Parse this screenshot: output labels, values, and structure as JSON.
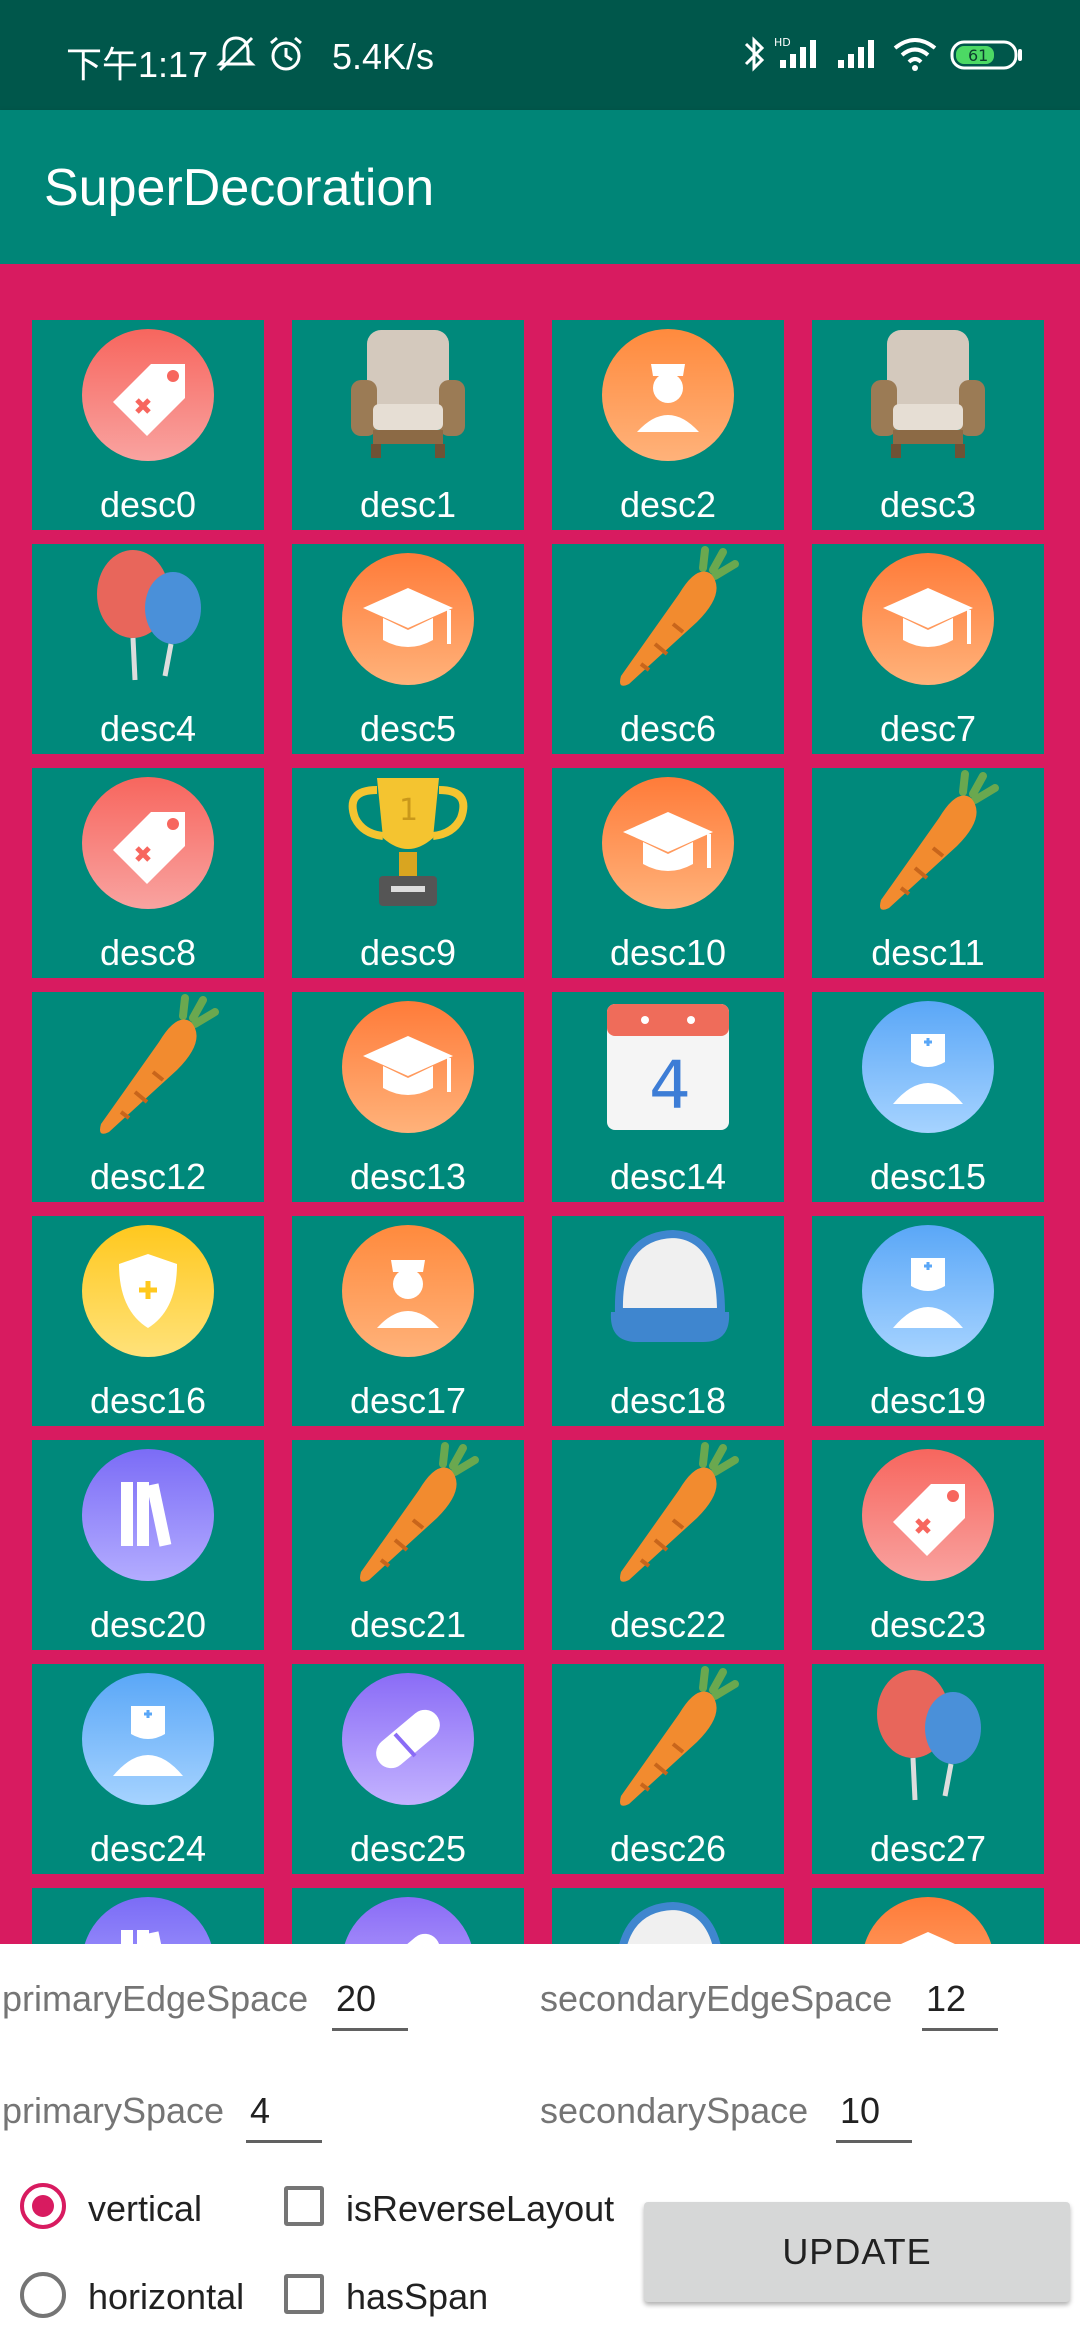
{
  "status_bar": {
    "time": "下午1:17",
    "speed": "5.4K/s",
    "battery": "61",
    "background": "#00574b"
  },
  "app_bar": {
    "title": "SuperDecoration",
    "color": "#008577"
  },
  "grid": {
    "background": "#d81b60",
    "cell_color": "#00897b",
    "items": [
      {
        "label": "desc0",
        "icon": "tag-icon"
      },
      {
        "label": "desc1",
        "icon": "sofa-icon"
      },
      {
        "label": "desc2",
        "icon": "nurse-icon"
      },
      {
        "label": "desc3",
        "icon": "sofa-icon"
      },
      {
        "label": "desc4",
        "icon": "balloons-icon"
      },
      {
        "label": "desc5",
        "icon": "graduation-cap-icon"
      },
      {
        "label": "desc6",
        "icon": "carrot-icon"
      },
      {
        "label": "desc7",
        "icon": "graduation-cap-icon"
      },
      {
        "label": "desc8",
        "icon": "tag-icon"
      },
      {
        "label": "desc9",
        "icon": "trophy-icon"
      },
      {
        "label": "desc10",
        "icon": "graduation-cap-icon"
      },
      {
        "label": "desc11",
        "icon": "carrot-icon"
      },
      {
        "label": "desc12",
        "icon": "carrot-icon"
      },
      {
        "label": "desc13",
        "icon": "graduation-cap-icon"
      },
      {
        "label": "desc14",
        "icon": "calendar-icon"
      },
      {
        "label": "desc15",
        "icon": "doctor-icon"
      },
      {
        "label": "desc16",
        "icon": "shield-icon"
      },
      {
        "label": "desc17",
        "icon": "nurse-icon"
      },
      {
        "label": "desc18",
        "icon": "cap-icon"
      },
      {
        "label": "desc19",
        "icon": "doctor-icon"
      },
      {
        "label": "desc20",
        "icon": "books-icon"
      },
      {
        "label": "desc21",
        "icon": "carrot-icon"
      },
      {
        "label": "desc22",
        "icon": "carrot-icon"
      },
      {
        "label": "desc23",
        "icon": "tag-icon"
      },
      {
        "label": "desc24",
        "icon": "doctor-icon"
      },
      {
        "label": "desc25",
        "icon": "pill-icon"
      },
      {
        "label": "desc26",
        "icon": "carrot-icon"
      },
      {
        "label": "desc27",
        "icon": "balloons-icon"
      },
      {
        "label": "",
        "icon": "books-icon"
      },
      {
        "label": "",
        "icon": "pill-icon"
      },
      {
        "label": "",
        "icon": "cap-icon"
      },
      {
        "label": "",
        "icon": "graduation-cap-icon"
      }
    ]
  },
  "controls": {
    "primary_edge_space": {
      "label": "primaryEdgeSpace",
      "value": "20"
    },
    "secondary_edge_space": {
      "label": "secondaryEdgeSpace",
      "value": "12"
    },
    "primary_space": {
      "label": "primarySpace",
      "value": "4"
    },
    "secondary_space": {
      "label": "secondarySpace",
      "value": "10"
    },
    "orientation": {
      "vertical_label": "vertical",
      "horizontal_label": "horizontal",
      "selected": "vertical"
    },
    "is_reverse_layout": {
      "label": "isReverseLayout",
      "checked": false
    },
    "has_span": {
      "label": "hasSpan",
      "checked": false
    },
    "update_button": "UPDATE",
    "accent": "#d81b60"
  }
}
